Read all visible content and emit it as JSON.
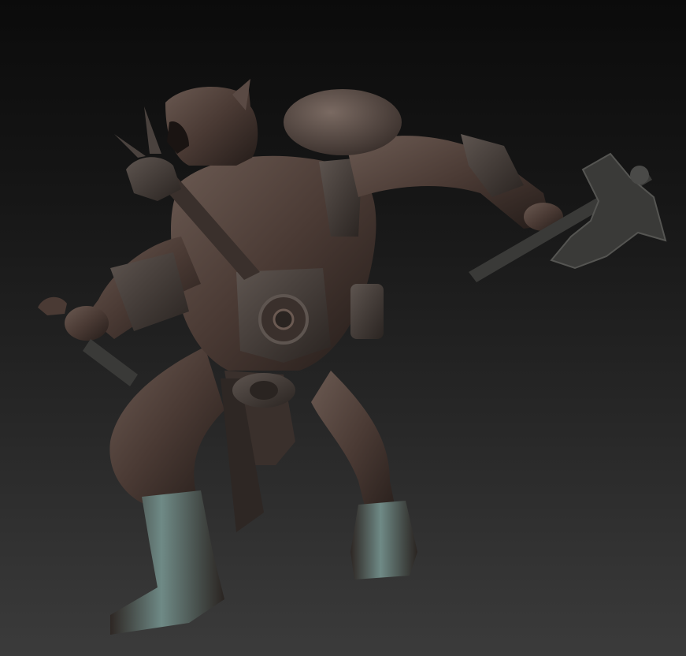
{
  "scene": {
    "subject": "sculpted-orc-warrior",
    "colors": {
      "background_top": "#0b0b0b",
      "background_bottom": "#3b3b3b",
      "skin": "#4a3a34",
      "skin_dark": "#2e2420",
      "skin_light": "#6b5a52",
      "armor": "#3e3632",
      "armor_light": "#5e5550",
      "metal": "#3a3a38",
      "highlight": "#6f8a86"
    }
  }
}
